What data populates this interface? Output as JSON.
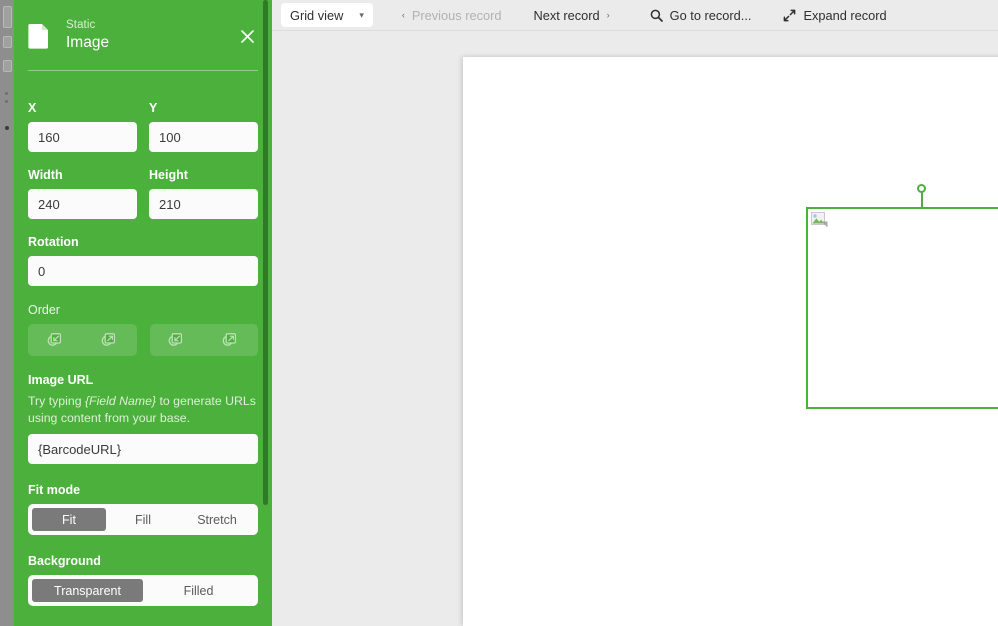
{
  "panel": {
    "icon": "document-icon",
    "eyebrow": "Static",
    "title": "Image",
    "close_label": "×",
    "accent_color": "#4cb03c",
    "fields": {
      "x": {
        "label": "X",
        "value": "160"
      },
      "y": {
        "label": "Y",
        "value": "100"
      },
      "width": {
        "label": "Width",
        "value": "240"
      },
      "height": {
        "label": "Height",
        "value": "210"
      },
      "rotation": {
        "label": "Rotation",
        "value": "0"
      }
    },
    "order": {
      "label": "Order",
      "buttons": [
        {
          "name": "send-to-back-icon",
          "title": "Send to back"
        },
        {
          "name": "send-backward-icon",
          "title": "Send backward"
        },
        {
          "name": "bring-forward-icon",
          "title": "Bring forward"
        },
        {
          "name": "bring-to-front-icon",
          "title": "Bring to front"
        }
      ]
    },
    "image_url": {
      "label": "Image URL",
      "hint_before": "Try typing ",
      "hint_token": "{Field Name}",
      "hint_after": " to generate URLs using content from your base.",
      "value": "{BarcodeURL}",
      "placeholder": "Image URL"
    },
    "fit_mode": {
      "label": "Fit mode",
      "options": [
        "Fit",
        "Fill",
        "Stretch"
      ],
      "selected": "Fit"
    },
    "background": {
      "label": "Background",
      "options": [
        "Transparent",
        "Filled"
      ],
      "selected": "Transparent"
    }
  },
  "toolbar": {
    "view_select": {
      "label": "Grid view",
      "chevron": "▾"
    },
    "previous_record": {
      "label": "Previous record",
      "chevron": "‹",
      "disabled": true
    },
    "next_record": {
      "label": "Next record",
      "chevron": "›"
    },
    "go_to_record": {
      "label": "Go to record...",
      "icon": "search-icon"
    },
    "expand_record": {
      "label": "Expand record",
      "icon": "expand-arrows-icon"
    }
  },
  "canvas": {
    "selection": {
      "rotation_handle": "rotation-handle",
      "resize_handle": "resize-handle",
      "placeholder_icon": "broken-image-icon"
    }
  }
}
